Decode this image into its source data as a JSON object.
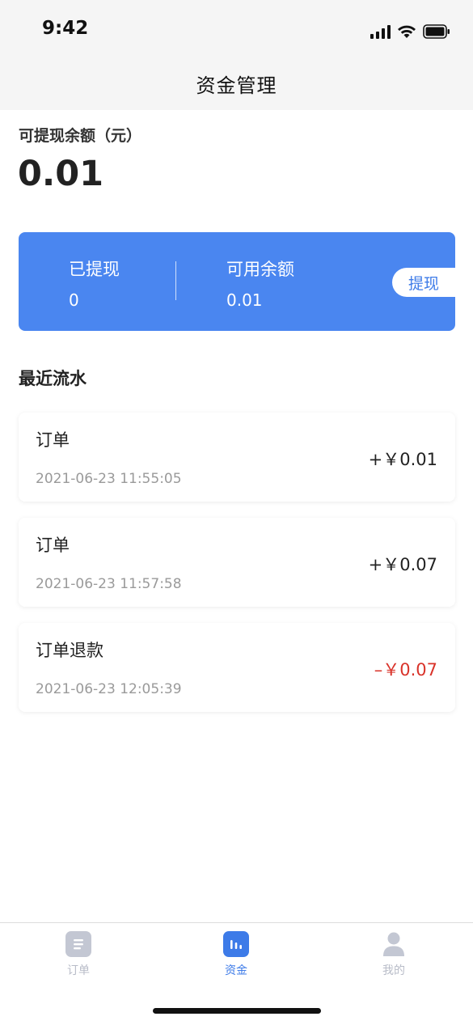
{
  "status_bar": {
    "time": "9:42"
  },
  "nav": {
    "title": "资金管理"
  },
  "balance": {
    "label": "可提现余额（元）",
    "value": "0.01"
  },
  "summary": {
    "withdrawn_label": "已提现",
    "withdrawn_value": "0",
    "available_label": "可用余额",
    "available_value": "0.01",
    "withdraw_button": "提现",
    "color": "#4a86f0"
  },
  "recent": {
    "title": "最近流水",
    "transactions": [
      {
        "title": "订单",
        "time": "2021-06-23 11:55:05",
        "amount": "+￥0.01"
      },
      {
        "title": "订单",
        "time": "2021-06-23 11:57:58",
        "amount": "+￥0.07"
      },
      {
        "title": "订单退款",
        "time": "2021-06-23 12:05:39",
        "amount": "–￥0.07",
        "color": "#d9332a"
      }
    ]
  },
  "tabs": [
    {
      "label": "订单",
      "icon": "list-icon"
    },
    {
      "label": "资金",
      "icon": "chart-bars-icon",
      "active": true
    },
    {
      "label": "我的",
      "icon": "person-icon"
    }
  ]
}
